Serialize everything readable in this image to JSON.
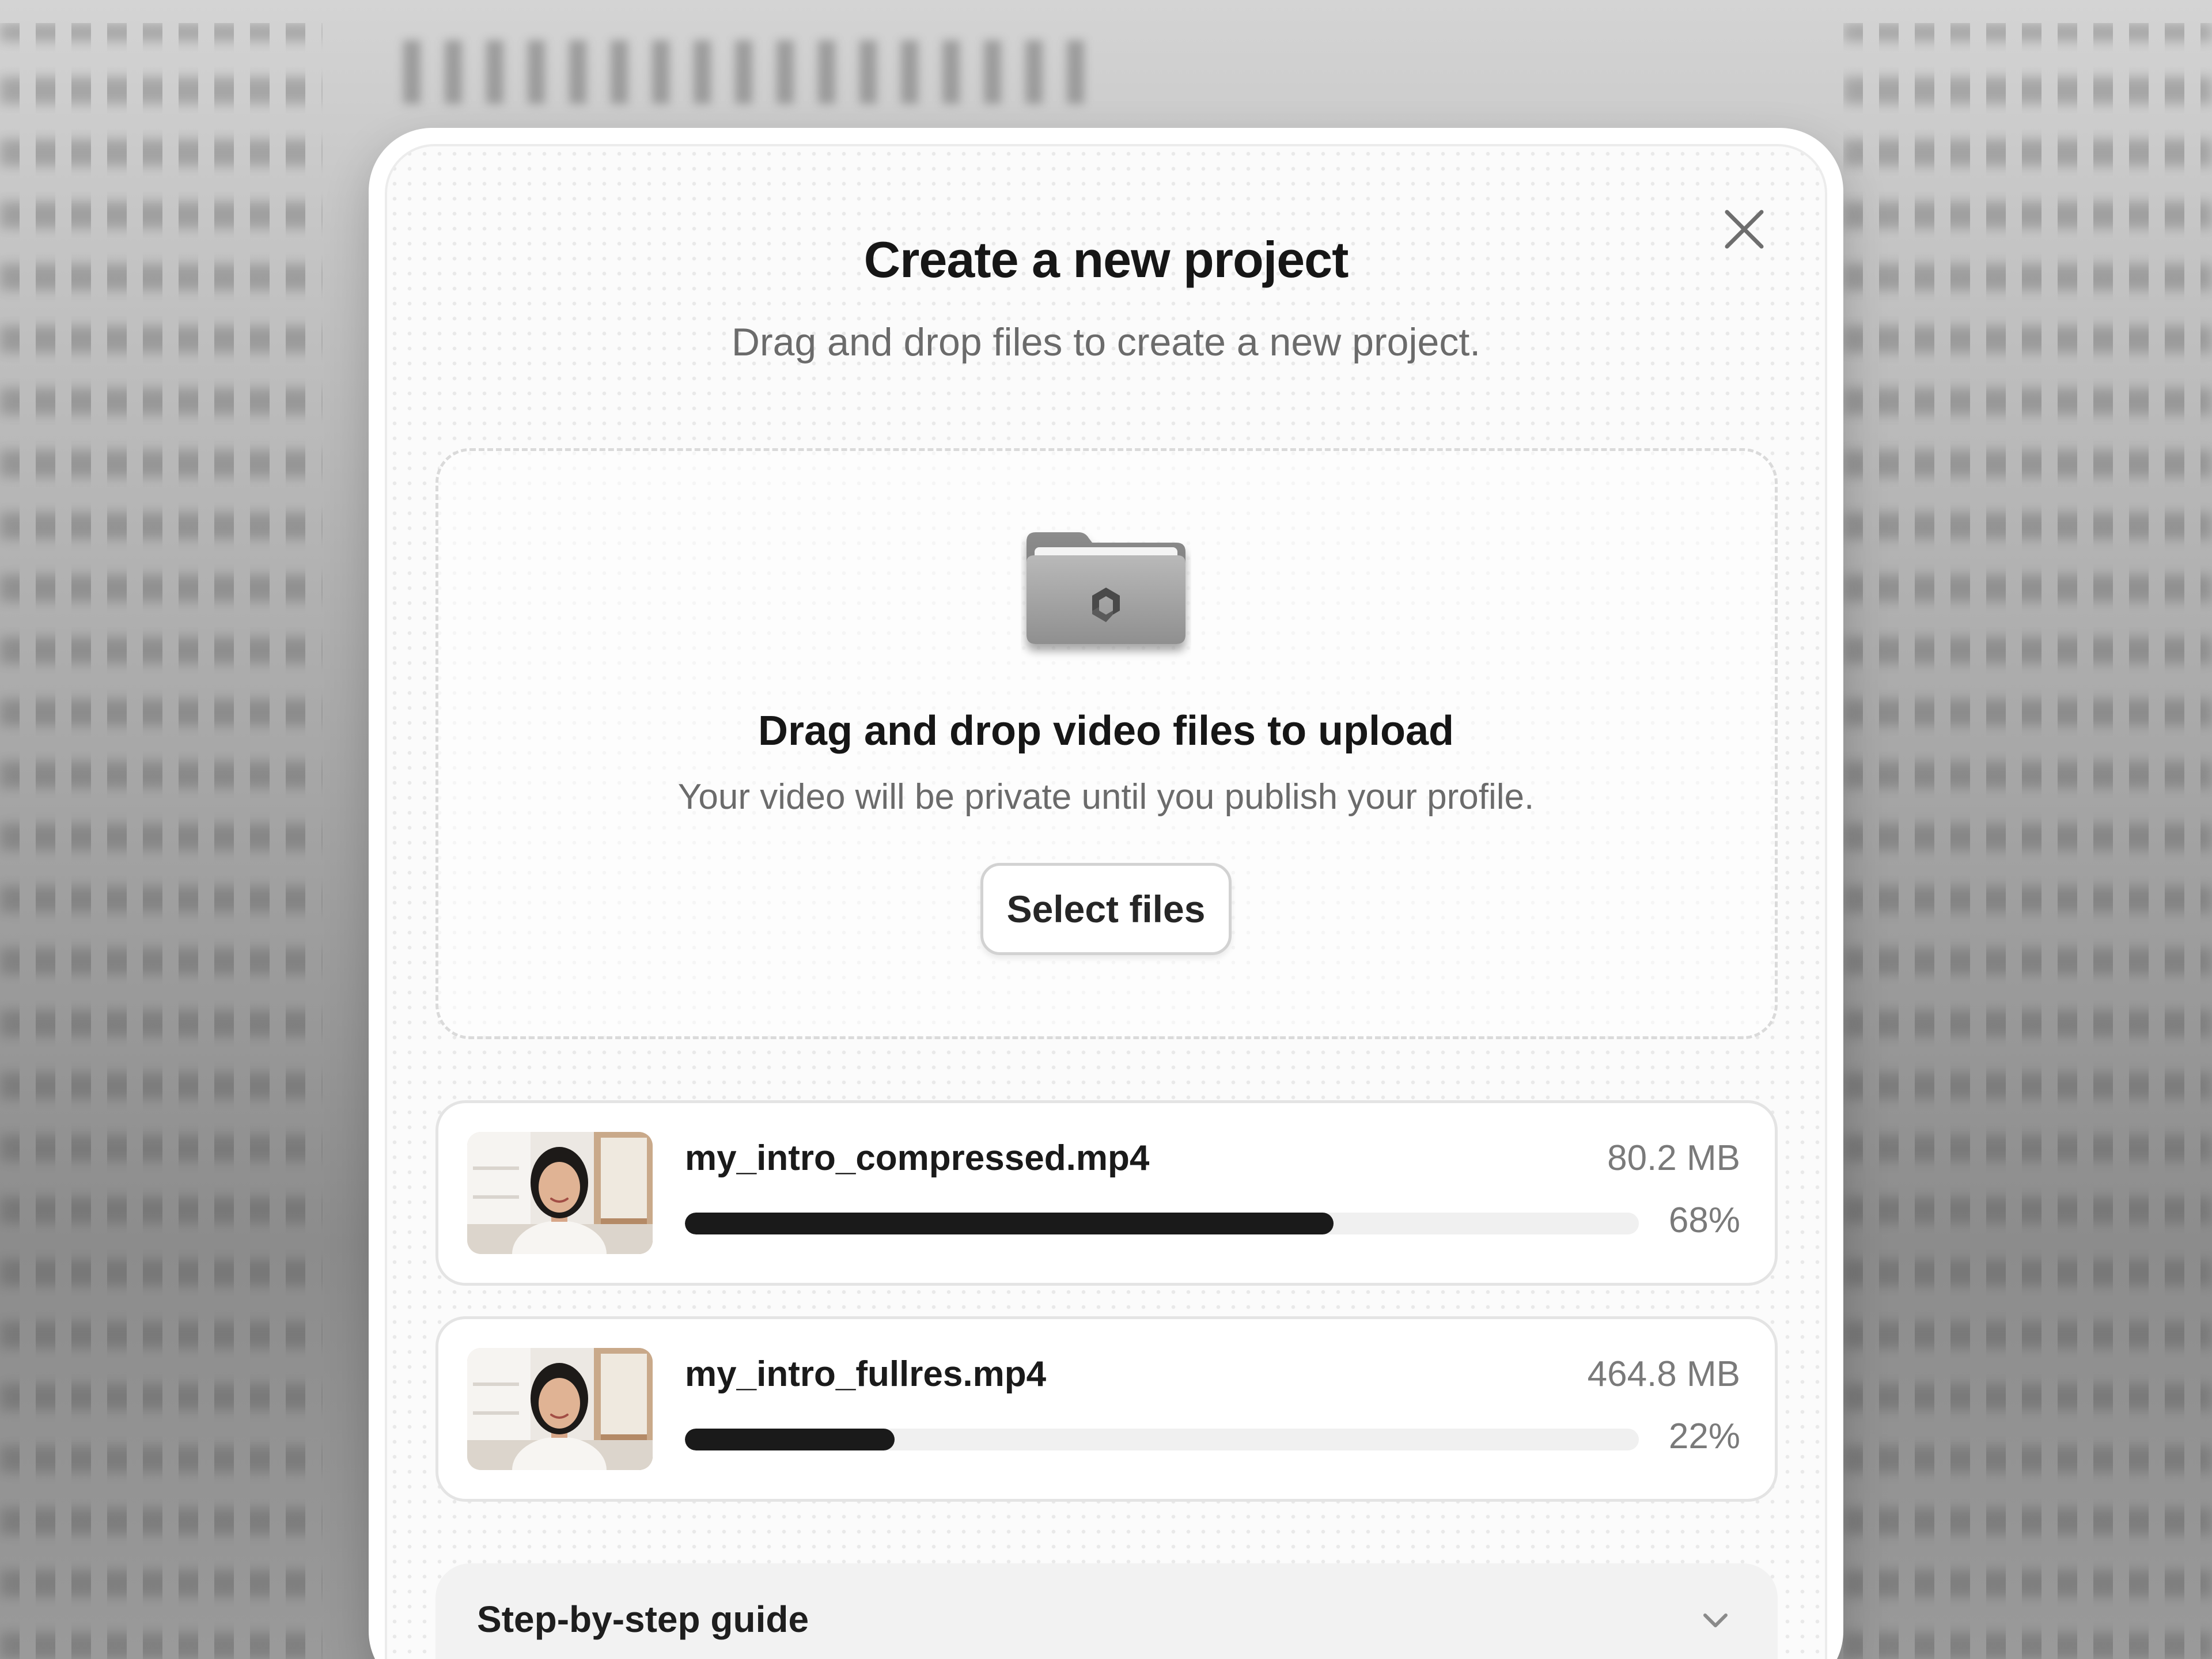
{
  "modal": {
    "title": "Create a new project",
    "subtitle": "Drag and drop files to create a new project.",
    "close_icon": "close-icon"
  },
  "dropzone": {
    "icon": "folder-icon",
    "title": "Drag and drop video files to upload",
    "description": "Your video will be private until you publish your profile.",
    "select_label": "Select files"
  },
  "uploads": [
    {
      "name": "my_intro_compressed.mp4",
      "size": "80.2 MB",
      "percent_label": "68%",
      "progress": 0.68
    },
    {
      "name": "my_intro_fullres.mp4",
      "size": "464.8 MB",
      "percent_label": "22%",
      "progress": 0.22
    }
  ],
  "guide": {
    "label": "Step-by-step guide",
    "icon": "chevron-down-icon"
  },
  "colors": {
    "progress_fill": "#1a1a1a",
    "progress_track": "#f0f0f0",
    "title_text": "#161616",
    "muted_text": "#6b6b6b"
  }
}
